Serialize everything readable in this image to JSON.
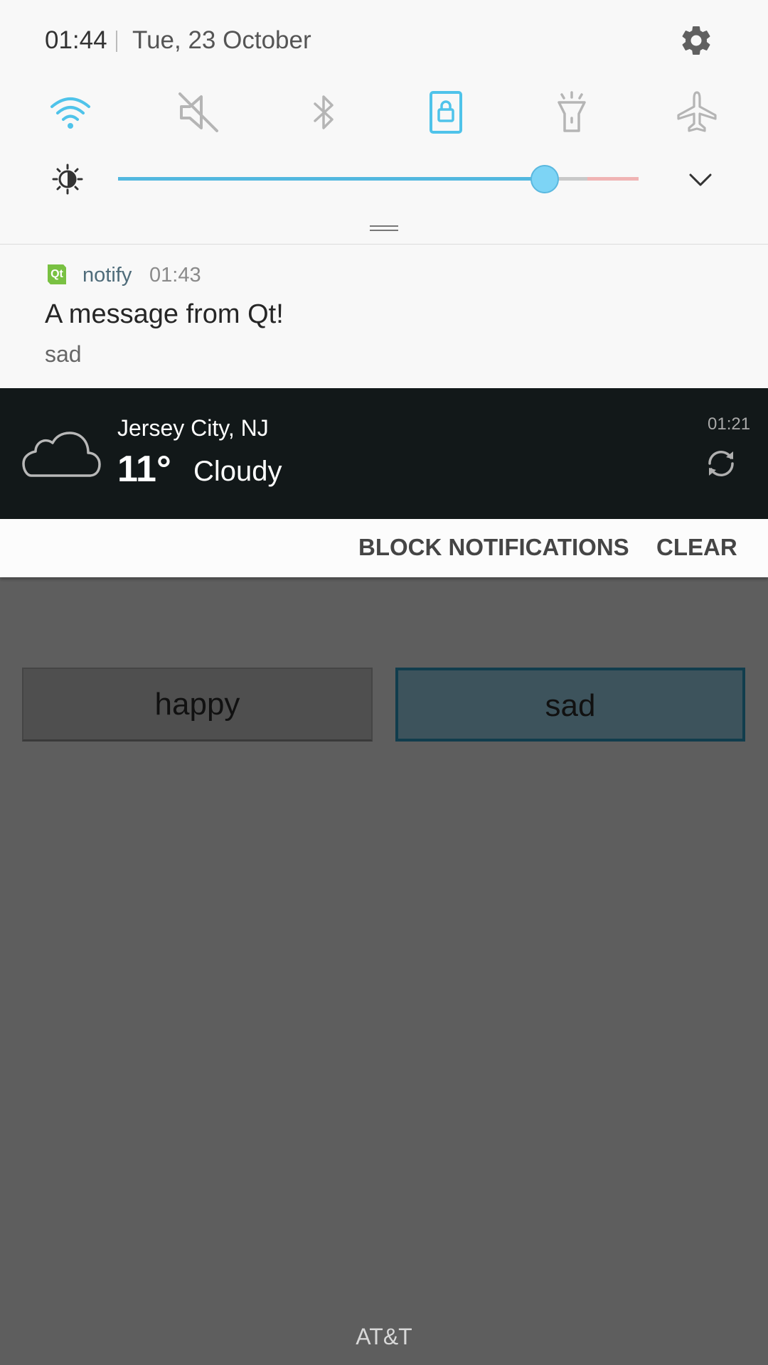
{
  "status": {
    "time": "01:44",
    "date": "Tue, 23 October"
  },
  "quick_settings": {
    "tiles": [
      {
        "icon": "wifi-icon",
        "active": true
      },
      {
        "icon": "mute-icon",
        "active": false
      },
      {
        "icon": "bluetooth-icon",
        "active": false
      },
      {
        "icon": "rotation-lock-icon",
        "active": true
      },
      {
        "icon": "flashlight-icon",
        "active": false
      },
      {
        "icon": "airplane-icon",
        "active": false
      }
    ],
    "brightness_level": 0.82,
    "accent_color": "#4fc3ea"
  },
  "notification": {
    "app": "notify",
    "time": "01:43",
    "title": "A message from Qt!",
    "body": "sad"
  },
  "weather": {
    "city": "Jersey City, NJ",
    "temperature": "11°",
    "condition": "Cloudy",
    "updated": "01:21"
  },
  "actions": {
    "block_label": "BLOCK NOTIFICATIONS",
    "clear_label": "CLEAR"
  },
  "app": {
    "happy_label": "happy",
    "sad_label": "sad"
  },
  "carrier": "AT&T"
}
